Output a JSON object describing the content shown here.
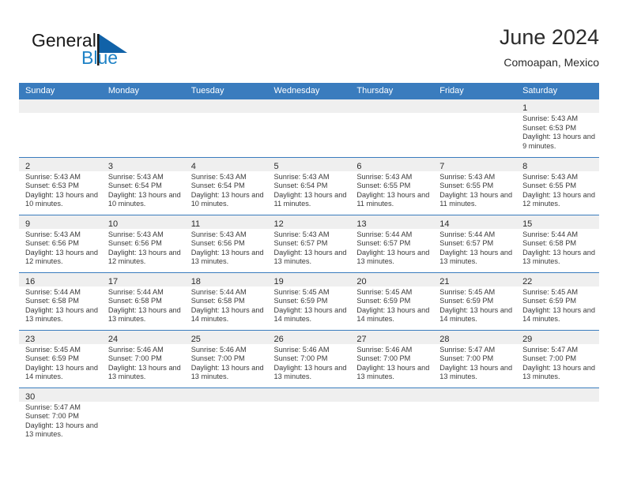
{
  "brand": {
    "name_part1": "General",
    "name_part2": "Blue",
    "flag_icon": "blue-flag-icon",
    "accent_color": "#1e82c6"
  },
  "header": {
    "title": "June 2024",
    "subtitle": "Comoapan, Mexico"
  },
  "theme": {
    "header_bg": "#3a7cbe",
    "header_text": "#ffffff",
    "row_divider": "#3a7cbe",
    "daynum_band_bg": "#efefef",
    "body_text": "#3a3a3a"
  },
  "weekday_headers": [
    "Sunday",
    "Monday",
    "Tuesday",
    "Wednesday",
    "Thursday",
    "Friday",
    "Saturday"
  ],
  "weeks": [
    [
      {
        "empty": true
      },
      {
        "empty": true
      },
      {
        "empty": true
      },
      {
        "empty": true
      },
      {
        "empty": true
      },
      {
        "empty": true
      },
      {
        "day": "1",
        "sunrise": "Sunrise: 5:43 AM",
        "sunset": "Sunset: 6:53 PM",
        "daylight": "Daylight: 13 hours and 9 minutes."
      }
    ],
    [
      {
        "day": "2",
        "sunrise": "Sunrise: 5:43 AM",
        "sunset": "Sunset: 6:53 PM",
        "daylight": "Daylight: 13 hours and 10 minutes."
      },
      {
        "day": "3",
        "sunrise": "Sunrise: 5:43 AM",
        "sunset": "Sunset: 6:54 PM",
        "daylight": "Daylight: 13 hours and 10 minutes."
      },
      {
        "day": "4",
        "sunrise": "Sunrise: 5:43 AM",
        "sunset": "Sunset: 6:54 PM",
        "daylight": "Daylight: 13 hours and 10 minutes."
      },
      {
        "day": "5",
        "sunrise": "Sunrise: 5:43 AM",
        "sunset": "Sunset: 6:54 PM",
        "daylight": "Daylight: 13 hours and 11 minutes."
      },
      {
        "day": "6",
        "sunrise": "Sunrise: 5:43 AM",
        "sunset": "Sunset: 6:55 PM",
        "daylight": "Daylight: 13 hours and 11 minutes."
      },
      {
        "day": "7",
        "sunrise": "Sunrise: 5:43 AM",
        "sunset": "Sunset: 6:55 PM",
        "daylight": "Daylight: 13 hours and 11 minutes."
      },
      {
        "day": "8",
        "sunrise": "Sunrise: 5:43 AM",
        "sunset": "Sunset: 6:55 PM",
        "daylight": "Daylight: 13 hours and 12 minutes."
      }
    ],
    [
      {
        "day": "9",
        "sunrise": "Sunrise: 5:43 AM",
        "sunset": "Sunset: 6:56 PM",
        "daylight": "Daylight: 13 hours and 12 minutes."
      },
      {
        "day": "10",
        "sunrise": "Sunrise: 5:43 AM",
        "sunset": "Sunset: 6:56 PM",
        "daylight": "Daylight: 13 hours and 12 minutes."
      },
      {
        "day": "11",
        "sunrise": "Sunrise: 5:43 AM",
        "sunset": "Sunset: 6:56 PM",
        "daylight": "Daylight: 13 hours and 13 minutes."
      },
      {
        "day": "12",
        "sunrise": "Sunrise: 5:43 AM",
        "sunset": "Sunset: 6:57 PM",
        "daylight": "Daylight: 13 hours and 13 minutes."
      },
      {
        "day": "13",
        "sunrise": "Sunrise: 5:44 AM",
        "sunset": "Sunset: 6:57 PM",
        "daylight": "Daylight: 13 hours and 13 minutes."
      },
      {
        "day": "14",
        "sunrise": "Sunrise: 5:44 AM",
        "sunset": "Sunset: 6:57 PM",
        "daylight": "Daylight: 13 hours and 13 minutes."
      },
      {
        "day": "15",
        "sunrise": "Sunrise: 5:44 AM",
        "sunset": "Sunset: 6:58 PM",
        "daylight": "Daylight: 13 hours and 13 minutes."
      }
    ],
    [
      {
        "day": "16",
        "sunrise": "Sunrise: 5:44 AM",
        "sunset": "Sunset: 6:58 PM",
        "daylight": "Daylight: 13 hours and 13 minutes."
      },
      {
        "day": "17",
        "sunrise": "Sunrise: 5:44 AM",
        "sunset": "Sunset: 6:58 PM",
        "daylight": "Daylight: 13 hours and 13 minutes."
      },
      {
        "day": "18",
        "sunrise": "Sunrise: 5:44 AM",
        "sunset": "Sunset: 6:58 PM",
        "daylight": "Daylight: 13 hours and 14 minutes."
      },
      {
        "day": "19",
        "sunrise": "Sunrise: 5:45 AM",
        "sunset": "Sunset: 6:59 PM",
        "daylight": "Daylight: 13 hours and 14 minutes."
      },
      {
        "day": "20",
        "sunrise": "Sunrise: 5:45 AM",
        "sunset": "Sunset: 6:59 PM",
        "daylight": "Daylight: 13 hours and 14 minutes."
      },
      {
        "day": "21",
        "sunrise": "Sunrise: 5:45 AM",
        "sunset": "Sunset: 6:59 PM",
        "daylight": "Daylight: 13 hours and 14 minutes."
      },
      {
        "day": "22",
        "sunrise": "Sunrise: 5:45 AM",
        "sunset": "Sunset: 6:59 PM",
        "daylight": "Daylight: 13 hours and 14 minutes."
      }
    ],
    [
      {
        "day": "23",
        "sunrise": "Sunrise: 5:45 AM",
        "sunset": "Sunset: 6:59 PM",
        "daylight": "Daylight: 13 hours and 14 minutes."
      },
      {
        "day": "24",
        "sunrise": "Sunrise: 5:46 AM",
        "sunset": "Sunset: 7:00 PM",
        "daylight": "Daylight: 13 hours and 13 minutes."
      },
      {
        "day": "25",
        "sunrise": "Sunrise: 5:46 AM",
        "sunset": "Sunset: 7:00 PM",
        "daylight": "Daylight: 13 hours and 13 minutes."
      },
      {
        "day": "26",
        "sunrise": "Sunrise: 5:46 AM",
        "sunset": "Sunset: 7:00 PM",
        "daylight": "Daylight: 13 hours and 13 minutes."
      },
      {
        "day": "27",
        "sunrise": "Sunrise: 5:46 AM",
        "sunset": "Sunset: 7:00 PM",
        "daylight": "Daylight: 13 hours and 13 minutes."
      },
      {
        "day": "28",
        "sunrise": "Sunrise: 5:47 AM",
        "sunset": "Sunset: 7:00 PM",
        "daylight": "Daylight: 13 hours and 13 minutes."
      },
      {
        "day": "29",
        "sunrise": "Sunrise: 5:47 AM",
        "sunset": "Sunset: 7:00 PM",
        "daylight": "Daylight: 13 hours and 13 minutes."
      }
    ],
    [
      {
        "day": "30",
        "sunrise": "Sunrise: 5:47 AM",
        "sunset": "Sunset: 7:00 PM",
        "daylight": "Daylight: 13 hours and 13 minutes."
      },
      {
        "empty": true
      },
      {
        "empty": true
      },
      {
        "empty": true
      },
      {
        "empty": true
      },
      {
        "empty": true
      },
      {
        "empty": true
      }
    ]
  ]
}
